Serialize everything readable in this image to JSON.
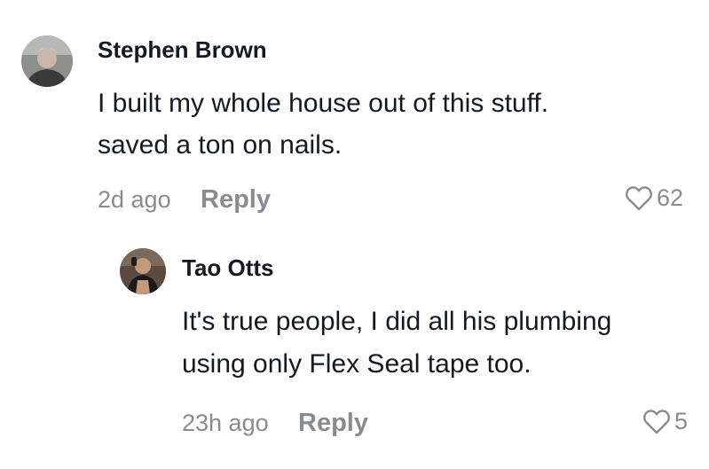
{
  "comments": [
    {
      "author": "Stephen Brown",
      "text_lines": [
        "I built my whole house out of this stuff.",
        "saved a ton on nails."
      ],
      "time": "2d ago",
      "reply_label": "Reply",
      "likes": "62",
      "avatar_icon": "user-photo",
      "like_icon": "heart-outline-icon"
    }
  ],
  "replies": [
    {
      "author": "Tao Otts",
      "text_lines": [
        "It's true people, I did all his plumbing",
        "using only Flex Seal tape too."
      ],
      "time": "23h ago",
      "reply_label": "Reply",
      "likes": "5",
      "avatar_icon": "user-photo",
      "like_icon": "heart-outline-icon"
    }
  ],
  "colors": {
    "text_primary": "#161823",
    "text_secondary": "#8a8b91",
    "background": "#ffffff"
  }
}
